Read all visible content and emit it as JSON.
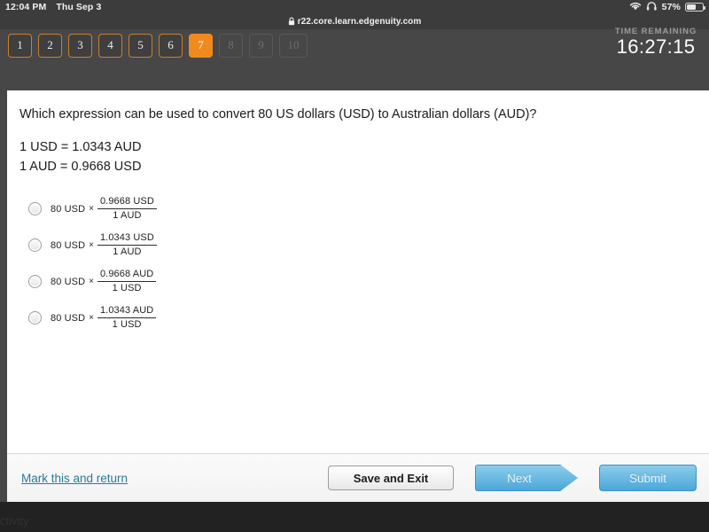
{
  "status_bar": {
    "time": "12:04 PM",
    "date": "Thu Sep 3",
    "battery_percent": "57%",
    "wifi_icon": "wifi-icon",
    "headphones_icon": "headphones-icon",
    "battery_icon": "battery-icon"
  },
  "browser": {
    "url": "r22.core.learn.edgenuity.com",
    "lock_icon": "lock-icon"
  },
  "quiz_nav": {
    "questions": [
      {
        "label": "1",
        "state": "seen"
      },
      {
        "label": "2",
        "state": "seen"
      },
      {
        "label": "3",
        "state": "seen"
      },
      {
        "label": "4",
        "state": "seen"
      },
      {
        "label": "5",
        "state": "seen"
      },
      {
        "label": "6",
        "state": "seen"
      },
      {
        "label": "7",
        "state": "active"
      },
      {
        "label": "8",
        "state": "locked"
      },
      {
        "label": "9",
        "state": "locked"
      },
      {
        "label": "10",
        "state": "locked"
      }
    ]
  },
  "timer": {
    "label": "TIME REMAINING",
    "value": "16:27:15"
  },
  "question": {
    "stem": "Which expression can be used to convert 80 US dollars (USD) to Australian dollars (AUD)?",
    "given": [
      "1 USD = 1.0343 AUD",
      "1 AUD = 0.9668 USD"
    ],
    "choices": [
      {
        "lead": "80 USD",
        "times": "×",
        "numerator": "0.9668 USD",
        "denominator": "1 AUD",
        "selected": false
      },
      {
        "lead": "80 USD",
        "times": "×",
        "numerator": "1.0343 USD",
        "denominator": "1 AUD",
        "selected": false
      },
      {
        "lead": "80 USD",
        "times": "×",
        "numerator": "0.9668 AUD",
        "denominator": "1 USD",
        "selected": false
      },
      {
        "lead": "80 USD",
        "times": "×",
        "numerator": "1.0343 AUD",
        "denominator": "1 USD",
        "selected": false
      }
    ]
  },
  "actions": {
    "mark_link": "Mark this and return",
    "save_and_exit": "Save and Exit",
    "next": "Next",
    "submit": "Submit"
  },
  "os_bottom": {
    "text": "ctivity"
  },
  "colors": {
    "accent_orange": "#f08a1e",
    "link_teal": "#2a7b96",
    "button_blue": "#4ba7d8",
    "chrome_dark": "#474747"
  }
}
